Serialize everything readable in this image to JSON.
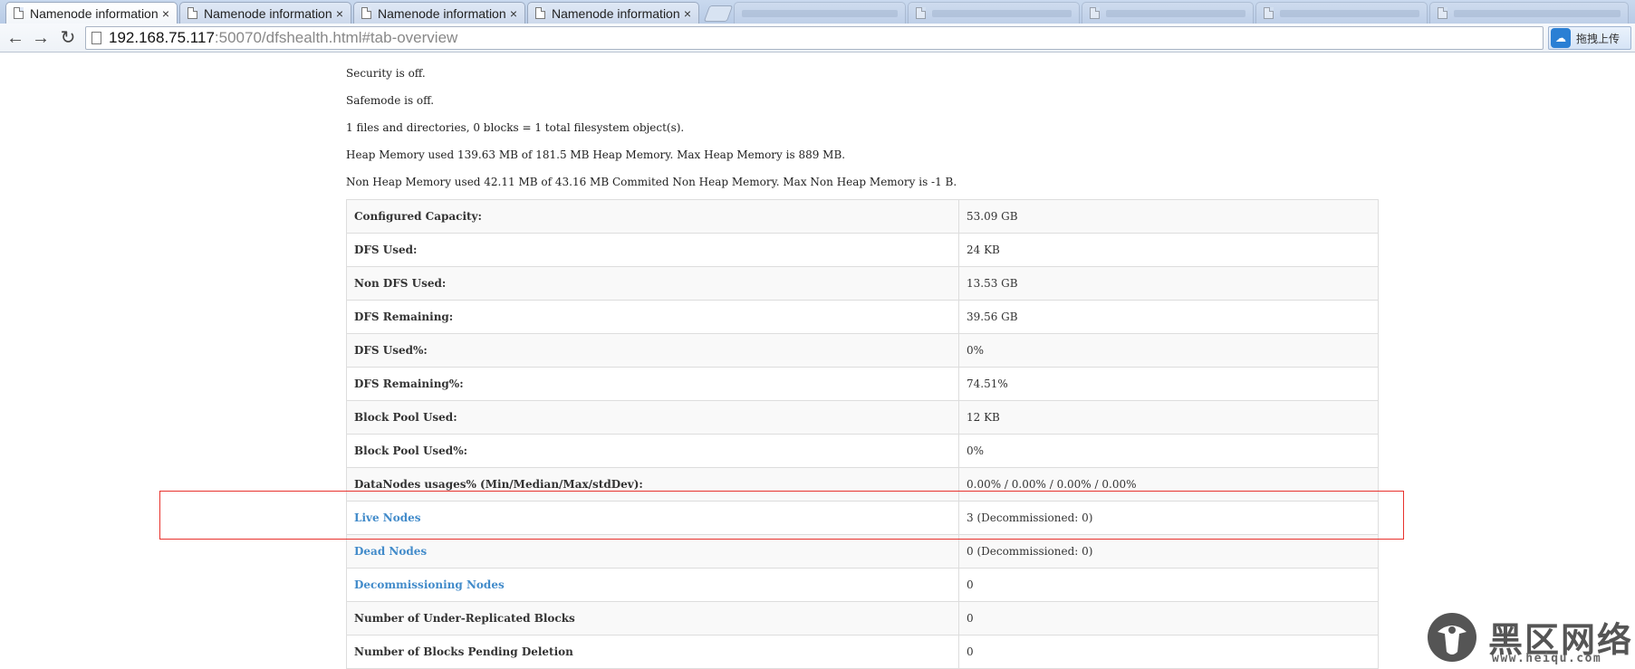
{
  "browser": {
    "tabs": [
      {
        "title": "Namenode information",
        "active": true
      },
      {
        "title": "Namenode information",
        "active": false
      },
      {
        "title": "Namenode information",
        "active": false
      },
      {
        "title": "Namenode information",
        "active": false
      }
    ],
    "close_glyph": "×",
    "url_host": "192.168.75.117",
    "url_rest": ":50070/dfshealth.html#tab-overview",
    "extension_label": "拖拽上传"
  },
  "overview": {
    "security": "Security is off.",
    "safemode": "Safemode is off.",
    "objects": "1 files and directories, 0 blocks = 1 total filesystem object(s).",
    "heap": "Heap Memory used 139.63 MB of 181.5 MB Heap Memory. Max Heap Memory is 889 MB.",
    "nonheap": "Non Heap Memory used 42.11 MB of 43.16 MB Commited Non Heap Memory. Max Non Heap Memory is -1 B."
  },
  "summary": [
    {
      "key": "Configured Capacity:",
      "value": "53.09 GB",
      "link": false
    },
    {
      "key": "DFS Used:",
      "value": "24 KB",
      "link": false
    },
    {
      "key": "Non DFS Used:",
      "value": "13.53 GB",
      "link": false
    },
    {
      "key": "DFS Remaining:",
      "value": "39.56 GB",
      "link": false
    },
    {
      "key": "DFS Used%:",
      "value": "0%",
      "link": false
    },
    {
      "key": "DFS Remaining%:",
      "value": "74.51%",
      "link": false
    },
    {
      "key": "Block Pool Used:",
      "value": "12 KB",
      "link": false
    },
    {
      "key": "Block Pool Used%:",
      "value": "0%",
      "link": false
    },
    {
      "key": "DataNodes usages% (Min/Median/Max/stdDev):",
      "value": "0.00% / 0.00% / 0.00% / 0.00%",
      "link": false
    },
    {
      "key": "Live Nodes",
      "value": "3 (Decommissioned: 0)",
      "link": true
    },
    {
      "key": "Dead Nodes",
      "value": "0 (Decommissioned: 0)",
      "link": true
    },
    {
      "key": "Decommissioning Nodes",
      "value": "0",
      "link": true
    },
    {
      "key": "Number of Under-Replicated Blocks",
      "value": "0",
      "link": false
    },
    {
      "key": "Number of Blocks Pending Deletion",
      "value": "0",
      "link": false
    }
  ],
  "watermark": {
    "name": "黑区网络",
    "url": "www.heiqu.com",
    "color": "#555555"
  }
}
